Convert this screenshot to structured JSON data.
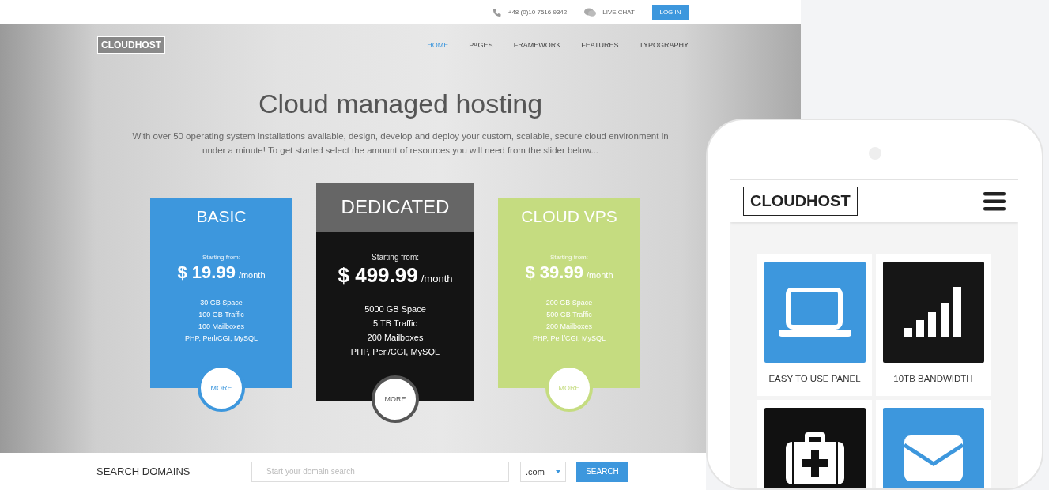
{
  "topbar": {
    "phone": "+48 (0)10 7516 9342",
    "chat": "LIVE CHAT",
    "login": "LOG IN"
  },
  "header": {
    "logo": "CLOUDHOST",
    "nav": [
      {
        "label": "HOME",
        "selected": true
      },
      {
        "label": "PAGES",
        "selected": false
      },
      {
        "label": "FRAMEWORK",
        "selected": false
      },
      {
        "label": "FEATURES",
        "selected": false
      },
      {
        "label": "TYPOGRAPHY",
        "selected": false
      }
    ]
  },
  "hero": {
    "title": "Cloud managed hosting",
    "description": "With over 50 operating system installations available, design, develop and deploy your custom, scalable, secure cloud environment in under a minute! To get started select the amount of resources you will need from the slider below..."
  },
  "plans": [
    {
      "name": "BASIC",
      "kind": "standard",
      "color": "#3d97dd",
      "starting": "Starting from:",
      "price": "$ 19.99",
      "period": "/month",
      "features": [
        "30 GB Space",
        "100 GB Traffic",
        "100 Mailboxes",
        "PHP, Perl/CGI, MySQL"
      ],
      "button": "MORE"
    },
    {
      "name": "DEDICATED",
      "kind": "featured",
      "color": "#141414",
      "starting": "Starting from:",
      "price": "$ 499.99",
      "period": "/month",
      "features": [
        "5000 GB Space",
        "5 TB Traffic",
        "200 Mailboxes",
        "PHP, Perl/CGI, MySQL"
      ],
      "button": "MORE"
    },
    {
      "name": "CLOUD VPS",
      "kind": "standard",
      "color": "#c5dc80",
      "starting": "Starting from:",
      "price": "$ 39.99",
      "period": "/month",
      "features": [
        "200 GB Space",
        "500 GB Traffic",
        "200 Mailboxes",
        "PHP, Perl/CGI, MySQL"
      ],
      "button": "MORE"
    }
  ],
  "search": {
    "label": "SEARCH DOMAINS",
    "placeholder": "Start your domain search",
    "tld": ".com",
    "button": "SEARCH"
  },
  "phone": {
    "logo": "CLOUDHOST",
    "tiles": [
      {
        "kind": "laptop",
        "color": "#3d97dd",
        "label": "EASY TO USE PANEL"
      },
      {
        "kind": "bars",
        "color": "#161616",
        "label": "10TB BANDWIDTH"
      },
      {
        "kind": "medkit",
        "color": "#111111"
      },
      {
        "kind": "envelope",
        "color": "#3d97dd"
      }
    ]
  }
}
